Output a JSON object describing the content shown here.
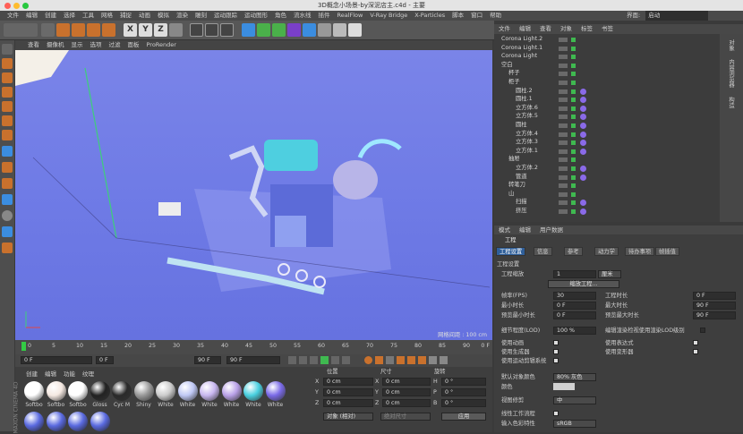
{
  "window": {
    "title": "3D概念小场景-by深泥店主.c4d - 主要"
  },
  "menubar": {
    "items": [
      "文件",
      "编辑",
      "创建",
      "选择",
      "工具",
      "网格",
      "捕捉",
      "动画",
      "模拟",
      "渲染",
      "雕刻",
      "运动跟踪",
      "运动图形",
      "角色",
      "流水线",
      "插件",
      "RealFlow",
      "V-Ray Bridge",
      "X-Particles",
      "脚本",
      "窗口",
      "帮助"
    ],
    "layout_label": "界面:",
    "layout_value": "启动"
  },
  "viewport": {
    "menu": [
      "查看",
      "摄像机",
      "显示",
      "选项",
      "过滤",
      "面板",
      "ProRender"
    ],
    "grid_info": "网格间距 : 100 cm"
  },
  "timeline": {
    "ticks": [
      "0",
      "5",
      "10",
      "15",
      "20",
      "25",
      "30",
      "35",
      "40",
      "45",
      "50",
      "55",
      "60",
      "65",
      "70",
      "75",
      "80",
      "85",
      "90"
    ],
    "end_label": "0 F"
  },
  "transport": {
    "start_field": "0 F",
    "current_field": "0 F",
    "end_field": "90 F",
    "end_field2": "90 F"
  },
  "materials": {
    "menu": [
      "创建",
      "编辑",
      "功能",
      "纹理"
    ],
    "items": [
      "Softbo",
      "Softbo",
      "Softbo",
      "Gloss",
      "Cyc M",
      "Shiny",
      "White",
      "White",
      "White",
      "White",
      "White",
      "White"
    ],
    "side_logo": "MAXON CINEMA 4D"
  },
  "coords": {
    "headers": [
      "位置",
      "尺寸",
      "旋转"
    ],
    "rows": [
      {
        "axis": "X",
        "pos": "0 cm",
        "size": "0 cm",
        "rot_axis": "H",
        "rot": "0 °"
      },
      {
        "axis": "Y",
        "pos": "0 cm",
        "size": "0 cm",
        "rot_axis": "P",
        "rot": "0 °"
      },
      {
        "axis": "Z",
        "pos": "0 cm",
        "size": "0 cm",
        "rot_axis": "B",
        "rot": "0 °"
      }
    ],
    "mode": "对象 (相对)",
    "size_mode": "绝对尺寸",
    "apply": "应用"
  },
  "objects": {
    "menu": [
      "文件",
      "编辑",
      "查看",
      "对象",
      "标签",
      "书签"
    ],
    "rows": [
      {
        "name": "Corona Light.2",
        "indent": 0
      },
      {
        "name": "Corona Light.1",
        "indent": 0
      },
      {
        "name": "Corona Light",
        "indent": 0
      },
      {
        "name": "空白",
        "indent": 0
      },
      {
        "name": "杯子",
        "indent": 1
      },
      {
        "name": "柜子",
        "indent": 1
      },
      {
        "name": "圆柱.2",
        "indent": 2
      },
      {
        "name": "圆柱.1",
        "indent": 2
      },
      {
        "name": "立方体.6",
        "indent": 2
      },
      {
        "name": "立方体.5",
        "indent": 2
      },
      {
        "name": "圆柱",
        "indent": 2
      },
      {
        "name": "立方体.4",
        "indent": 2
      },
      {
        "name": "立方体.3",
        "indent": 2
      },
      {
        "name": "立方体.1",
        "indent": 2
      },
      {
        "name": "抽屉",
        "indent": 1
      },
      {
        "name": "立方体.2",
        "indent": 2
      },
      {
        "name": "管道",
        "indent": 2
      },
      {
        "name": "转笔刀",
        "indent": 1
      },
      {
        "name": "山",
        "indent": 1
      },
      {
        "name": "扫描",
        "indent": 2
      },
      {
        "name": "挤压",
        "indent": 2
      }
    ],
    "side_labels": [
      "对象",
      "内容浏览器",
      "构造"
    ]
  },
  "attributes": {
    "menu": [
      "模式",
      "编辑",
      "用户数据"
    ],
    "header": "工程",
    "tabs": [
      "工程设置",
      "信息",
      "参考",
      "动力学",
      "待办事项",
      "帧插值"
    ],
    "section": "工程设置",
    "scale_label": "工程缩放",
    "scale_value": "1",
    "scale_unit": "厘米",
    "scale_button": "缩放工程...",
    "fields": [
      {
        "label": "帧率(FPS)",
        "value": "30",
        "label2": "工程时长",
        "value2": "0 F"
      },
      {
        "label": "最小时长",
        "value": "0 F",
        "label2": "最大时长",
        "value2": "90 F"
      },
      {
        "label": "预览最小时长",
        "value": "0 F",
        "label2": "预览最大时长",
        "value2": "90 F"
      }
    ],
    "lod_label": "细节程度(LOD)",
    "lod_value": "100 %",
    "lod_check_label": "编辑渲染检视使用渲染LOD级别",
    "checks_left": [
      "使用动画",
      "使用生成器",
      "使用运动剪辑系统"
    ],
    "checks_right": [
      "使用表达式",
      "使用变形器"
    ],
    "default_color_label": "默认对象颜色",
    "default_color_value": "80% 灰色",
    "color_label": "颜色",
    "view_clip_label": "视图修剪",
    "view_clip_value": "中",
    "linear_label": "线性工作流程",
    "input_color_label": "输入色彩特性",
    "input_color_value": "sRGB"
  },
  "colors": {
    "accent": "#c9712d",
    "viewport": "#6f7be6",
    "timeline_green": "#33cc44"
  }
}
